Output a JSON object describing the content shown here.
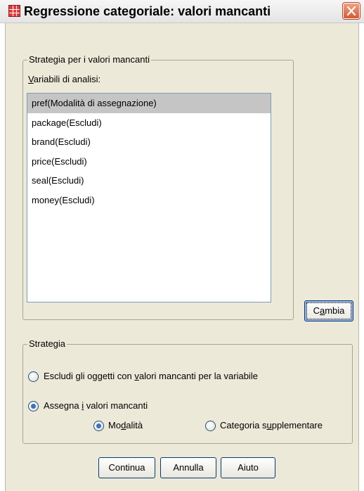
{
  "window": {
    "title": "Regressione categoriale: valori mancanti",
    "icon": "spreadsheet-grid-icon",
    "close_icon": "close-x-icon"
  },
  "missing_strategy_group": {
    "legend": "Strategia per i valori mancanti",
    "list_label_ul": "V",
    "list_label_rest": "ariabili di analisi:",
    "variables": [
      "pref(Modalità di assegnazione)",
      "package(Escludi)",
      "brand(Escludi)",
      "price(Escludi)",
      "seal(Escludi)",
      "money(Escludi)"
    ],
    "change_button": {
      "label_pre": "C",
      "label_ul": "a",
      "label_post": "mbia"
    }
  },
  "strategy_group": {
    "legend": "Strategia",
    "exclude_option": {
      "pre": "Escludi gli oggetti con ",
      "ul": "v",
      "post": "alori mancanti per la variabile",
      "checked": false
    },
    "impute_option": {
      "pre": "Assegna ",
      "ul": "i",
      "post": " valori mancanti",
      "checked": true
    },
    "mode_option": {
      "pre": "Mo",
      "ul": "d",
      "post": "alità",
      "checked": true
    },
    "extra_category_option": {
      "pre": "Categoria s",
      "ul": "u",
      "post": "pplementare",
      "checked": false
    }
  },
  "footer": {
    "continue_label": "Continua",
    "cancel_label": "Annulla",
    "help_label": "Aiuto"
  },
  "colors": {
    "dialog_face": "#ece9d8",
    "selection": "#c5c5c5",
    "close_button": "#d45a32",
    "radio_dot": "#3a72c4"
  }
}
